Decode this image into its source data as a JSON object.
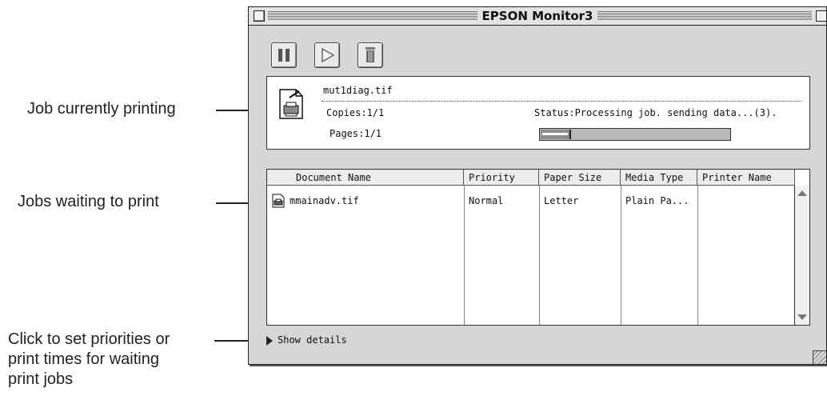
{
  "callouts": {
    "current": "Job currently printing",
    "waiting": "Jobs waiting to print",
    "details_line1": "Click to set priorities or",
    "details_line2": "print times for waiting",
    "details_line3": "print jobs"
  },
  "window": {
    "title": "EPSON Monitor3"
  },
  "toolbar": {
    "pause_icon": "pause-icon",
    "resume_icon": "play-icon",
    "delete_icon": "trash-icon"
  },
  "current_job": {
    "filename": "mut1diag.tif",
    "copies": "Copies:1/1",
    "pages": "Pages:1/1",
    "status": "Status:Processing job. sending data...(3).",
    "progress": 0.15
  },
  "queue": {
    "columns": [
      "Document Name",
      "Priority",
      "Paper Size",
      "Media Type",
      "Printer Name"
    ],
    "rows": [
      {
        "document": "mmainadv.tif",
        "priority": "Normal",
        "paper_size": "Letter",
        "media_type": "Plain Pa...",
        "printer_name": ""
      }
    ]
  },
  "footer": {
    "show_details": "Show details"
  }
}
